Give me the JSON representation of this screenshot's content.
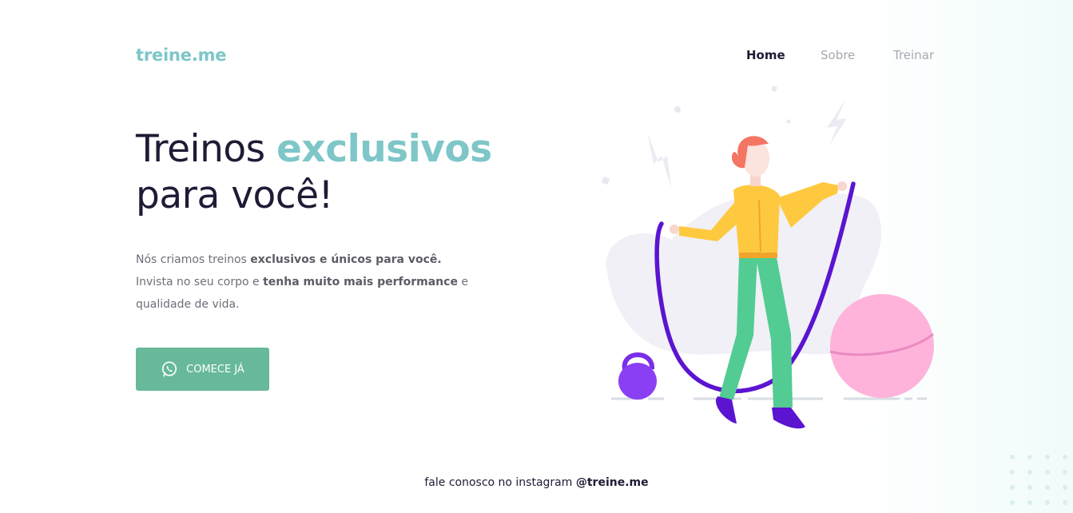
{
  "brand": {
    "logo": "treine.me"
  },
  "nav": {
    "items": [
      {
        "label": "Home",
        "active": true
      },
      {
        "label": "Sobre",
        "active": false
      },
      {
        "label": "Treinar",
        "active": false
      }
    ]
  },
  "hero": {
    "title_part1": "Treinos ",
    "title_accent": "exclusivos",
    "title_part2": "para você!",
    "desc_line1_plain": "Nós criamos treinos ",
    "desc_line1_bold": "exclusivos e únicos para você.",
    "desc_line2_plain": "Invista no seu corpo e ",
    "desc_line2_bold": "tenha muito mais performance",
    "desc_line2_end": " e",
    "desc_line3": "qualidade de vida.",
    "cta_label": "COMECE JÁ",
    "cta_icon": "whatsapp-icon"
  },
  "footer": {
    "text": "fale conosco no instagram ",
    "handle": "@treine.me"
  },
  "colors": {
    "accent": "#7ec6c8",
    "button": "#67b99a",
    "text_dark": "#1f1b35",
    "text_muted": "#a7a9b2"
  }
}
